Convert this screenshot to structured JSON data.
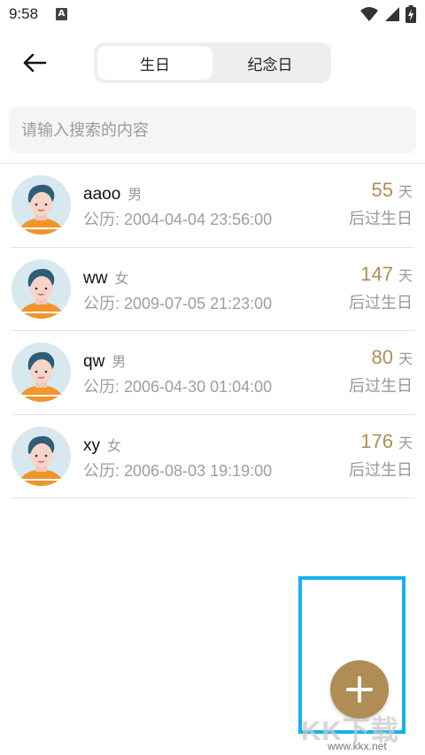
{
  "status_bar": {
    "time": "9:58",
    "notification_icon_letter": "A",
    "icons": [
      "wifi-icon",
      "signal-icon",
      "battery-charging-icon"
    ]
  },
  "header": {
    "back_icon": "arrow-left-icon",
    "tabs": [
      {
        "label": "生日",
        "active": true
      },
      {
        "label": "纪念日",
        "active": false
      }
    ]
  },
  "search": {
    "placeholder": "请输入搜索的内容",
    "value": ""
  },
  "people": [
    {
      "name": "aaoo",
      "gender": "男",
      "date": "公历: 2004-04-04 23:56:00",
      "days": "55",
      "days_unit": "天",
      "countdown_label": "后过生日"
    },
    {
      "name": "ww",
      "gender": "女",
      "date": "公历: 2009-07-05 21:23:00",
      "days": "147",
      "days_unit": "天",
      "countdown_label": "后过生日"
    },
    {
      "name": "qw",
      "gender": "男",
      "date": "公历: 2006-04-30 01:04:00",
      "days": "80",
      "days_unit": "天",
      "countdown_label": "后过生日"
    },
    {
      "name": "xy",
      "gender": "女",
      "date": "公历: 2006-08-03 19:19:00",
      "days": "176",
      "days_unit": "天",
      "countdown_label": "后过生日"
    }
  ],
  "fab": {
    "icon": "plus-icon"
  },
  "watermark": {
    "text": "KK下载",
    "url": "www.kkx.net"
  },
  "colors": {
    "accent": "#b08d57",
    "highlight_box": "#13b3ea",
    "segment_bg": "#eeeeee",
    "search_bg": "#f5f5f5"
  }
}
